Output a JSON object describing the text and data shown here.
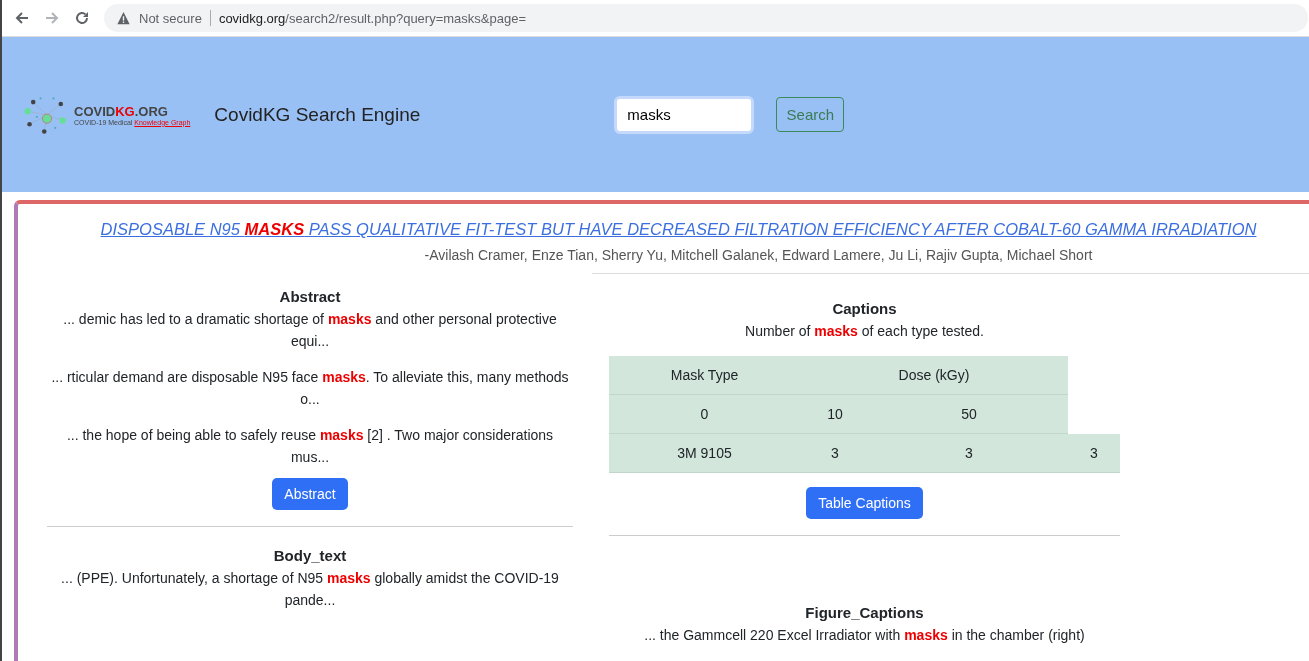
{
  "browser": {
    "security": "Not secure",
    "url_host": "covidkg.org",
    "url_path": "/search2/result.php?query=masks&page="
  },
  "header": {
    "logo_name_a": "COVID",
    "logo_name_b": "KG",
    "logo_name_c": ".ORG",
    "logo_tagline_a": "COVID-19 Medical ",
    "logo_tagline_b": "Knowledge Graph",
    "site_title": "CovidKG Search Engine",
    "search_value": "masks",
    "search_button": "Search"
  },
  "result": {
    "title": "DISPOSABLE N95 **MASKS** PASS QUALITATIVE FIT-TEST BUT HAVE DECREASED FILTRATION EFFICIENCY AFTER COBALT-60 GAMMA IRRADIATION",
    "authors": "-Avilash Cramer, Enze Tian, Sherry Yu, Mitchell Galanek, Edward Lamere, Ju Li, Rajiv Gupta, Michael Short"
  },
  "left_sections": [
    {
      "heading": "Abstract",
      "snippets": [
        "... demic has led to a dramatic shortage of **masks** and other personal protective equi...",
        "... rticular demand are disposable N95 face **masks**. To alleviate this, many methods o...",
        "... the hope of being able to safely reuse **masks** [2] . Two major considerations mus..."
      ],
      "button": "Abstract"
    },
    {
      "heading": "Body_text",
      "snippets": [
        "... (PPE). Unfortunately, a shortage of N95 **masks** globally amidst the COVID-19 pande..."
      ]
    }
  ],
  "captions": {
    "heading": "Captions",
    "text": "Number of **masks** of each type tested.",
    "table": [
      {
        "kind": "header",
        "cells": [
          "Mask Type",
          "Dose (kGy)"
        ]
      },
      {
        "kind": "body",
        "cells": [
          "0",
          "10",
          "50"
        ]
      },
      {
        "kind": "body",
        "cells": [
          "3M 9105",
          "3",
          "3",
          "3"
        ]
      }
    ],
    "button": "Table Captions"
  },
  "figure_captions": {
    "heading": "Figure_Captions",
    "text": "... the Gammcell 220 Excel Irradiator with **masks** in the chamber (right)"
  }
}
